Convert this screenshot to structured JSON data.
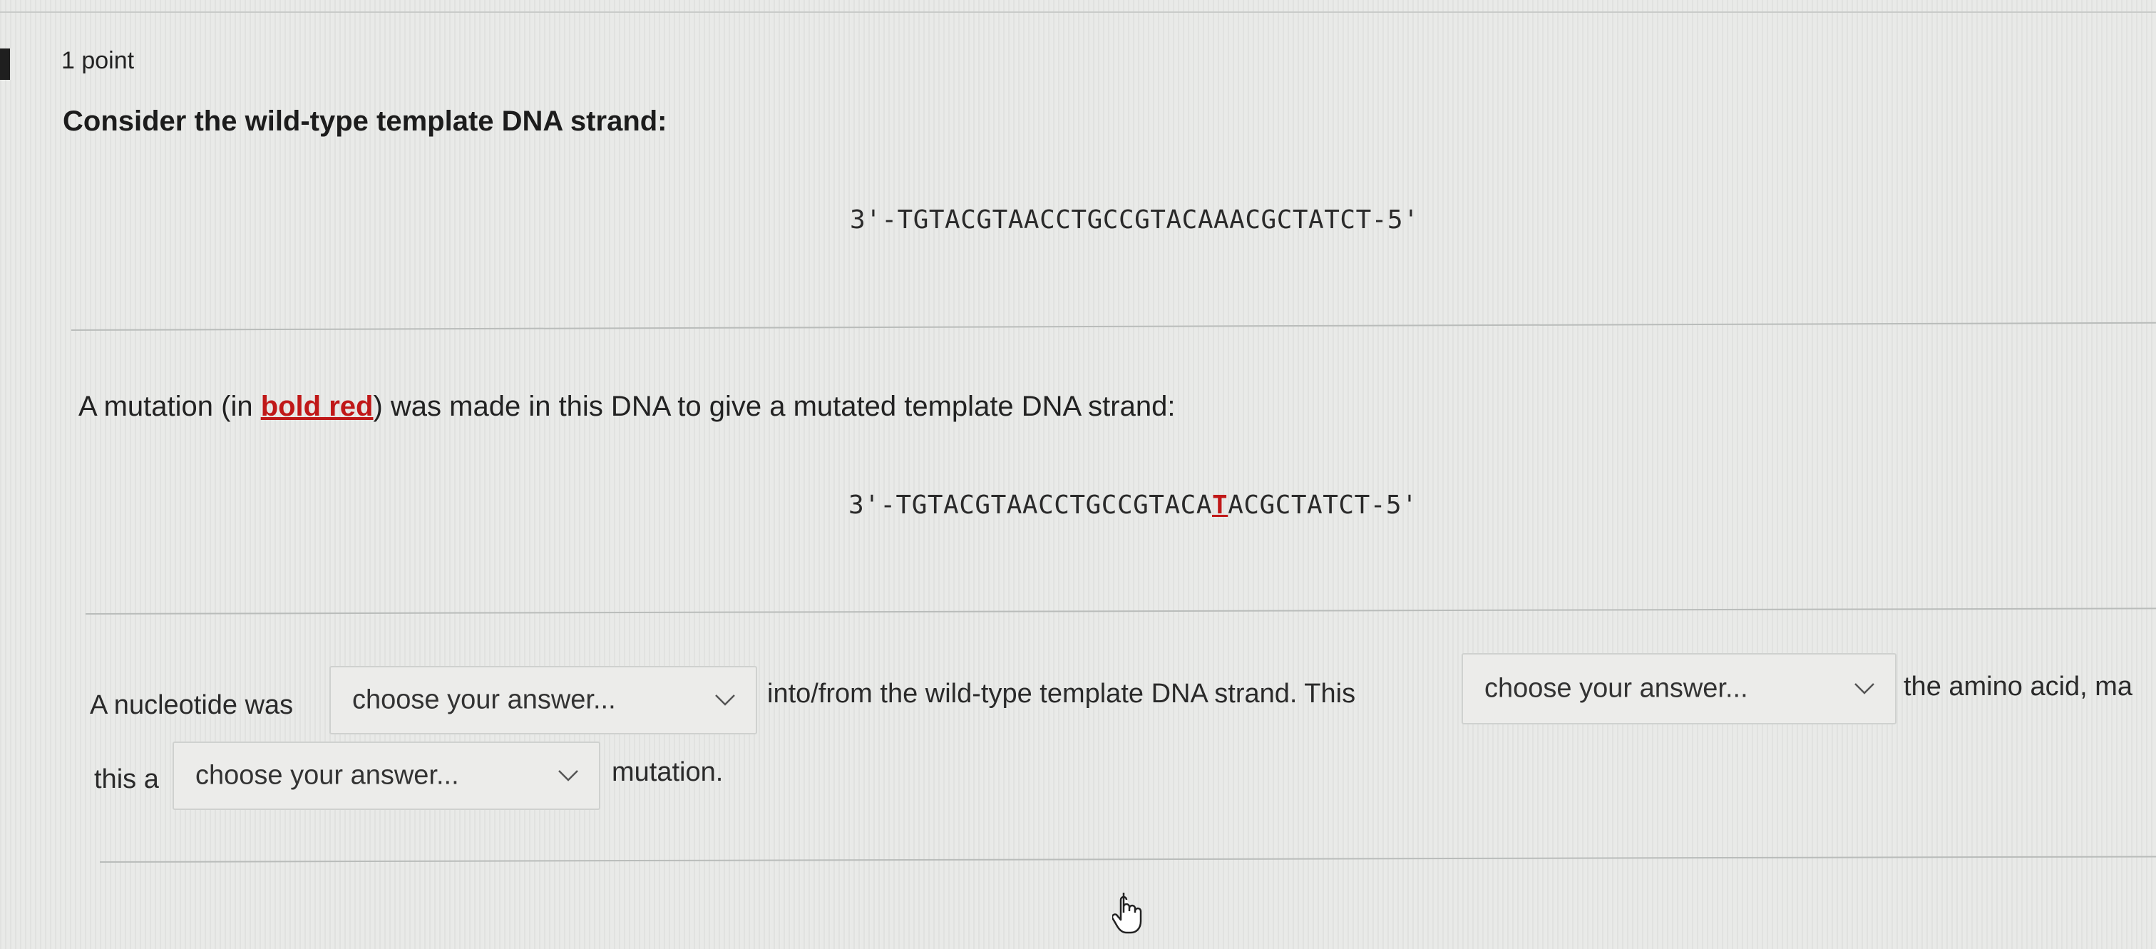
{
  "question": {
    "points": "1 point",
    "prompt": "Consider the wild-type template DNA strand:",
    "wild_type_strand": "3'-TGTACGTAACCTGCCGTACAAACGCTATCT-5'",
    "mutation_intro_before": "A mutation (in ",
    "mutation_intro_highlight": "bold red",
    "mutation_intro_after": ") was made in this DNA to give a mutated template DNA strand:",
    "mutated_strand_prefix": "3'-TGTACGTAACCTGCCGTACA",
    "mutated_strand_mutation": "T",
    "mutated_strand_suffix": "ACGCTATCT-5'"
  },
  "answer_sentence": {
    "part1": "A nucleotide was",
    "dropdown1": "choose your answer...",
    "part2": "into/from the wild-type template DNA strand. This",
    "dropdown2": "choose your answer...",
    "part3": "the amino acid, ma",
    "part4": "this a",
    "dropdown3": "choose your answer...",
    "part5": "mutation."
  },
  "colors": {
    "background": "#e9eae8",
    "mutation_red": "#c01818"
  },
  "icons": {
    "dropdown": "chevron-down-icon",
    "cursor": "hand-pointer-icon"
  }
}
